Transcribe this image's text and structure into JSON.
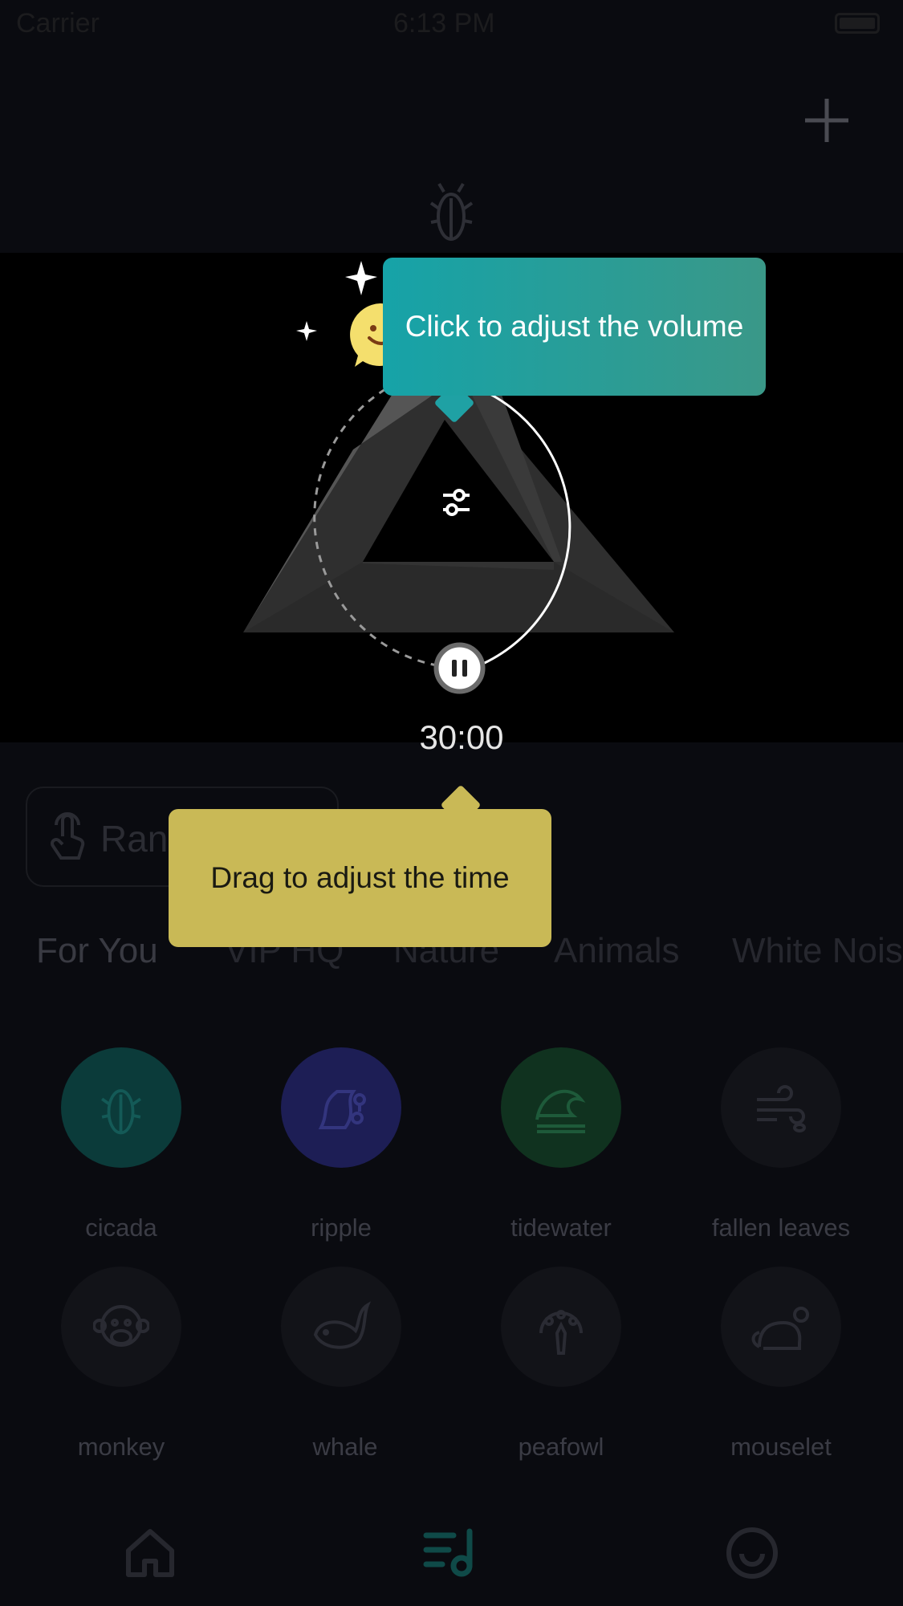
{
  "status_bar": {
    "carrier": "Carrier",
    "time": "6:13 PM"
  },
  "player": {
    "timer": "30:00",
    "volume_tip": "Click to adjust the volume",
    "time_tip": "Drag to adjust the time"
  },
  "random_button": {
    "label": "Ran"
  },
  "tabs": [
    "For You",
    "VIP HQ",
    "Nature",
    "Animals",
    "White Nois"
  ],
  "sounds": [
    {
      "label": "cicada",
      "icon": "cicada-icon",
      "color": "#0b3b3a"
    },
    {
      "label": "ripple",
      "icon": "ripple-icon",
      "color": "#1d1e55"
    },
    {
      "label": "tidewater",
      "icon": "wave-icon",
      "color": "#10321f"
    },
    {
      "label": "fallen leaves",
      "icon": "wind-icon",
      "color": "#121318"
    },
    {
      "label": "monkey",
      "icon": "monkey-icon",
      "color": "#121318"
    },
    {
      "label": "whale",
      "icon": "whale-icon",
      "color": "#121318"
    },
    {
      "label": "peafowl",
      "icon": "peafowl-icon",
      "color": "#121318"
    },
    {
      "label": "mouselet",
      "icon": "mouse-icon",
      "color": "#121318"
    }
  ],
  "nav": [
    "home-icon",
    "playlist-icon",
    "profile-icon"
  ],
  "colors": {
    "volume_tip": "#16a3a8",
    "time_tip": "#c9b956",
    "mascot": "#f4df6d"
  }
}
